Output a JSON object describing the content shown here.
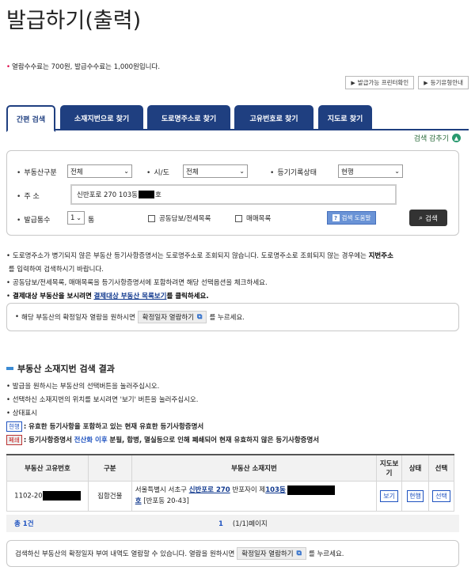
{
  "page": {
    "title": "발급하기(출력)"
  },
  "fee_note": "열람수수료는 700원, 발급수수료는 1,000원입니다.",
  "top_buttons": {
    "printer_check": "발급가능 프린터확인",
    "reg_types": "등기유형안내"
  },
  "tabs": [
    "간편 검색",
    "소재지번으로 찾기",
    "도로명주소로 찾기",
    "고유번호로 찾기",
    "지도로 찾기"
  ],
  "collapse_label": "검색 감추기",
  "form": {
    "property_type_label": "부동산구분",
    "property_type_value": "전체",
    "sido_label": "시/도",
    "sido_value": "전체",
    "reg_status_label": "등기기록상태",
    "reg_status_value": "현행",
    "address_label": "주 소",
    "address_value_prefix": "신반포로 270 103동",
    "address_value_suffix": "호",
    "copies_label": "발급통수",
    "copies_value": "1",
    "copies_unit": "통",
    "chk_joint": "공동담보/전세목록",
    "chk_sale": "매매목록",
    "help_button": "검색 도움말",
    "search_button": "검색"
  },
  "notes": {
    "n1a": "도로명주소가 병기되지 않은 부동산 등기사항증명서는 도로명주소로 조회되지 않습니다. 도로명주소로 조회되지 않는 경우에는",
    "n1b": "지번주소",
    "n1c": "를 입력하여 검색하시기 바랍니다.",
    "n2": "공동담보/전세목록, 매매목록을 등기사항증명서에 포함하려면 해당 선택옵션을 체크하세요.",
    "n3a": "결제대상 부동산을 보시려면",
    "n3b": "결제대상 부동산 목록보기",
    "n3c": "를 클릭하세요."
  },
  "confirm_box": {
    "prefix": "해당 부동산의 확정일자 열람을 원하시면",
    "button": "확정일자 열람하기",
    "suffix": "를 누르세요."
  },
  "results": {
    "title": "부동산 소재지번 검색 결과",
    "note1": "발급을 원하시는 부동산의 선택버튼을 눌러주십시오.",
    "note2": "선택하신 소재지번의 위치를 보시려면 '보기' 버튼을 눌러주십시오.",
    "note3": "상태표시",
    "badge_valid": "현행",
    "legend_valid": ": 유효한 등기사항을 포함하고 있는 현재 유효한 등기사항증명서",
    "badge_closed": "폐쇄",
    "legend_closed_a": ": 등기사항증명서",
    "legend_closed_b": "전산화 이후",
    "legend_closed_c": "분필, 합병, 멸실등으로 인해 폐쇄되어 현재 유효하지 않은 등기사항증명서",
    "columns": [
      "부동산 고유번호",
      "구분",
      "부동산 소재지번",
      "지도보기",
      "상태",
      "선택"
    ],
    "row": {
      "id_prefix": "1102-20",
      "type": "집합건물",
      "addr_a": "서울특별시 서초구",
      "addr_link1": "신반포로 270",
      "addr_b": "반포자이 제",
      "addr_link2": "103동",
      "addr_c": "호",
      "addr_d": "[반포동 20-43]",
      "map_btn": "보기",
      "status": "현행",
      "select_btn": "선택"
    },
    "total": "총 1건",
    "page_current": "1",
    "page_info": "(1/1)페이지"
  },
  "confirm_box2": {
    "prefix": "검색하신 부동산의 확정일자 부여 내역도 열람할 수 있습니다. 열람을 원하시면",
    "button": "확정일자 열람하기",
    "suffix": "를 누르세요."
  }
}
